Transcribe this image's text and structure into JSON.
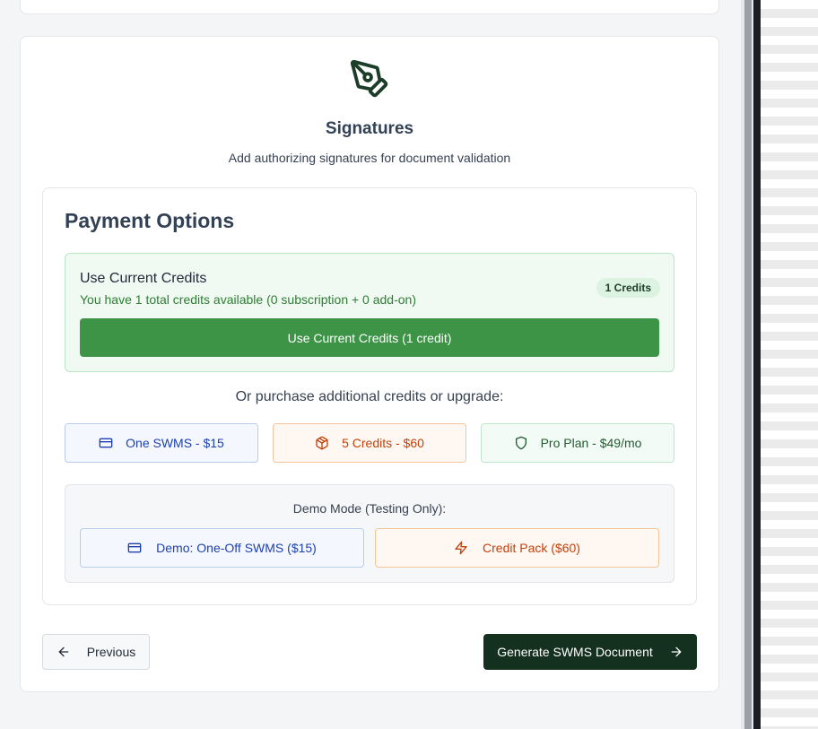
{
  "signatures": {
    "title": "Signatures",
    "subtitle": "Add authorizing signatures for document validation",
    "icon": "pen-tool-icon"
  },
  "payment": {
    "title": "Payment Options",
    "current_credits": {
      "heading": "Use Current Credits",
      "description": "You have 1 total credits available (0 subscription + 0 add-on)",
      "badge": "1 Credits",
      "button_label": "Use Current Credits (1 credit)"
    },
    "purchase_prompt": "Or purchase additional credits or upgrade:",
    "options": [
      {
        "label": "One SWMS - $15",
        "icon": "credit-card-icon"
      },
      {
        "label": "5 Credits - $60",
        "icon": "package-icon"
      },
      {
        "label": "Pro Plan - $49/mo",
        "icon": "shield-icon"
      }
    ],
    "demo": {
      "label": "Demo Mode (Testing Only):",
      "buttons": [
        {
          "label": "Demo: One-Off SWMS ($15)",
          "icon": "credit-card-icon"
        },
        {
          "label": "Credit Pack ($60)",
          "icon": "zap-icon"
        }
      ]
    }
  },
  "nav": {
    "previous_label": "Previous",
    "generate_label": "Generate SWMS Document"
  },
  "colors": {
    "primary_dark": "#14301f",
    "success_green": "#3d9447",
    "accent_blue": "#1e40af",
    "accent_orange": "#c2410c"
  }
}
